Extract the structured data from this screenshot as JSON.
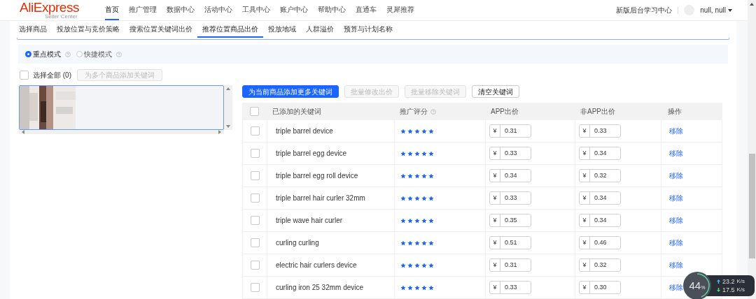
{
  "logo": {
    "brand": "AliExpress",
    "sub": "Seller Center"
  },
  "nav": [
    {
      "label": "首页",
      "selected": true
    },
    {
      "label": "推广管理",
      "selected": false
    },
    {
      "label": "数据中心",
      "selected": false
    },
    {
      "label": "活动中心",
      "selected": false
    },
    {
      "label": "工具中心",
      "selected": false
    },
    {
      "label": "账户中心",
      "selected": false
    },
    {
      "label": "帮助中心",
      "selected": false
    },
    {
      "label": "直通车",
      "selected": false
    },
    {
      "label": "灵犀推荐",
      "selected": false
    }
  ],
  "header_right": {
    "learning": "新版后台学习中心",
    "user": "null, null"
  },
  "steps": [
    {
      "label": "选择商品",
      "selected": false
    },
    {
      "label": "投放位置与竞价策略",
      "selected": false
    },
    {
      "label": "搜索位置关键词出价",
      "selected": false
    },
    {
      "label": "推荐位置商品出价",
      "selected": true
    },
    {
      "label": "投放地域",
      "selected": false
    },
    {
      "label": "人群溢价",
      "selected": false
    },
    {
      "label": "预算与计划名称",
      "selected": false
    }
  ],
  "modes": [
    {
      "label": "重点模式",
      "selected": true
    },
    {
      "label": "快捷模式",
      "selected": false
    }
  ],
  "select_all": {
    "label": "选择全部",
    "count": "(0)",
    "checked": false,
    "button": "为多个商品添加关键词"
  },
  "actions": [
    {
      "label": "为当前商品添加更多关键词",
      "kind": "primary"
    },
    {
      "label": "批量修改出价",
      "kind": "disabled"
    },
    {
      "label": "批量移除关键词",
      "kind": "disabled"
    },
    {
      "label": "清空关键词",
      "kind": "normal"
    }
  ],
  "table": {
    "header_checked": false,
    "columns": [
      "已添加的关键词",
      "推广评分",
      "APP出价",
      "非APP出价",
      "操作"
    ],
    "rows": [
      {
        "keyword": "triple barrel device",
        "stars": 5,
        "currency": "¥",
        "app": "0.31",
        "non_app": "0.33",
        "action": "移除",
        "checked": false
      },
      {
        "keyword": "triple barrel egg device",
        "stars": 5,
        "currency": "¥",
        "app": "0.33",
        "non_app": "0.34",
        "action": "移除",
        "checked": false
      },
      {
        "keyword": "triple barrel egg roll device",
        "stars": 5,
        "currency": "¥",
        "app": "0.34",
        "non_app": "0.32",
        "action": "移除",
        "checked": false
      },
      {
        "keyword": "triple barrel hair curler 32mm",
        "stars": 5,
        "currency": "¥",
        "app": "0.33",
        "non_app": "0.34",
        "action": "移除",
        "checked": false
      },
      {
        "keyword": "triple wave hair curler",
        "stars": 5,
        "currency": "¥",
        "app": "0.35",
        "non_app": "0.34",
        "action": "移除",
        "checked": false
      },
      {
        "keyword": "curling curling",
        "stars": 5,
        "currency": "¥",
        "app": "0.51",
        "non_app": "0.46",
        "action": "移除",
        "checked": false
      },
      {
        "keyword": "electric hair curlers device",
        "stars": 5,
        "currency": "¥",
        "app": "0.31",
        "non_app": "0.32",
        "action": "移除",
        "checked": false
      },
      {
        "keyword": "curling iron 25 32mm device",
        "stars": 5,
        "currency": "¥",
        "app": "0.33",
        "non_app": "0.30",
        "action": "移除",
        "checked": false
      }
    ]
  },
  "net_widget": {
    "percent": "44",
    "unit": "%",
    "up": "23.2",
    "up_unit": "K/s",
    "down": "17.5",
    "down_unit": "K/s"
  }
}
